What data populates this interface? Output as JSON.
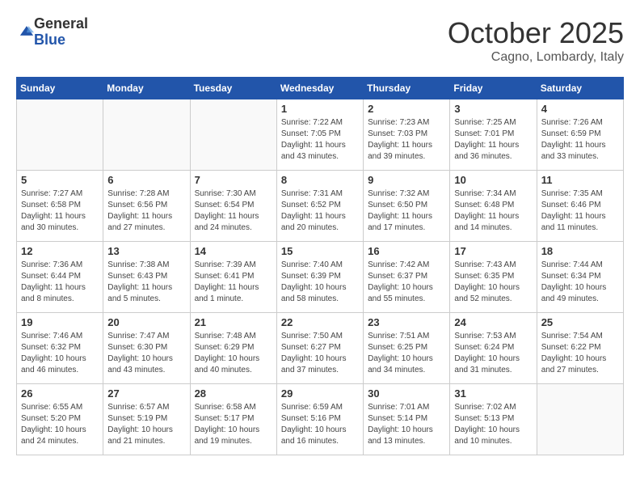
{
  "header": {
    "logo_general": "General",
    "logo_blue": "Blue",
    "month": "October 2025",
    "location": "Cagno, Lombardy, Italy"
  },
  "days_of_week": [
    "Sunday",
    "Monday",
    "Tuesday",
    "Wednesday",
    "Thursday",
    "Friday",
    "Saturday"
  ],
  "weeks": [
    [
      {
        "day": "",
        "info": ""
      },
      {
        "day": "",
        "info": ""
      },
      {
        "day": "",
        "info": ""
      },
      {
        "day": "1",
        "info": "Sunrise: 7:22 AM\nSunset: 7:05 PM\nDaylight: 11 hours\nand 43 minutes."
      },
      {
        "day": "2",
        "info": "Sunrise: 7:23 AM\nSunset: 7:03 PM\nDaylight: 11 hours\nand 39 minutes."
      },
      {
        "day": "3",
        "info": "Sunrise: 7:25 AM\nSunset: 7:01 PM\nDaylight: 11 hours\nand 36 minutes."
      },
      {
        "day": "4",
        "info": "Sunrise: 7:26 AM\nSunset: 6:59 PM\nDaylight: 11 hours\nand 33 minutes."
      }
    ],
    [
      {
        "day": "5",
        "info": "Sunrise: 7:27 AM\nSunset: 6:58 PM\nDaylight: 11 hours\nand 30 minutes."
      },
      {
        "day": "6",
        "info": "Sunrise: 7:28 AM\nSunset: 6:56 PM\nDaylight: 11 hours\nand 27 minutes."
      },
      {
        "day": "7",
        "info": "Sunrise: 7:30 AM\nSunset: 6:54 PM\nDaylight: 11 hours\nand 24 minutes."
      },
      {
        "day": "8",
        "info": "Sunrise: 7:31 AM\nSunset: 6:52 PM\nDaylight: 11 hours\nand 20 minutes."
      },
      {
        "day": "9",
        "info": "Sunrise: 7:32 AM\nSunset: 6:50 PM\nDaylight: 11 hours\nand 17 minutes."
      },
      {
        "day": "10",
        "info": "Sunrise: 7:34 AM\nSunset: 6:48 PM\nDaylight: 11 hours\nand 14 minutes."
      },
      {
        "day": "11",
        "info": "Sunrise: 7:35 AM\nSunset: 6:46 PM\nDaylight: 11 hours\nand 11 minutes."
      }
    ],
    [
      {
        "day": "12",
        "info": "Sunrise: 7:36 AM\nSunset: 6:44 PM\nDaylight: 11 hours\nand 8 minutes."
      },
      {
        "day": "13",
        "info": "Sunrise: 7:38 AM\nSunset: 6:43 PM\nDaylight: 11 hours\nand 5 minutes."
      },
      {
        "day": "14",
        "info": "Sunrise: 7:39 AM\nSunset: 6:41 PM\nDaylight: 11 hours\nand 1 minute."
      },
      {
        "day": "15",
        "info": "Sunrise: 7:40 AM\nSunset: 6:39 PM\nDaylight: 10 hours\nand 58 minutes."
      },
      {
        "day": "16",
        "info": "Sunrise: 7:42 AM\nSunset: 6:37 PM\nDaylight: 10 hours\nand 55 minutes."
      },
      {
        "day": "17",
        "info": "Sunrise: 7:43 AM\nSunset: 6:35 PM\nDaylight: 10 hours\nand 52 minutes."
      },
      {
        "day": "18",
        "info": "Sunrise: 7:44 AM\nSunset: 6:34 PM\nDaylight: 10 hours\nand 49 minutes."
      }
    ],
    [
      {
        "day": "19",
        "info": "Sunrise: 7:46 AM\nSunset: 6:32 PM\nDaylight: 10 hours\nand 46 minutes."
      },
      {
        "day": "20",
        "info": "Sunrise: 7:47 AM\nSunset: 6:30 PM\nDaylight: 10 hours\nand 43 minutes."
      },
      {
        "day": "21",
        "info": "Sunrise: 7:48 AM\nSunset: 6:29 PM\nDaylight: 10 hours\nand 40 minutes."
      },
      {
        "day": "22",
        "info": "Sunrise: 7:50 AM\nSunset: 6:27 PM\nDaylight: 10 hours\nand 37 minutes."
      },
      {
        "day": "23",
        "info": "Sunrise: 7:51 AM\nSunset: 6:25 PM\nDaylight: 10 hours\nand 34 minutes."
      },
      {
        "day": "24",
        "info": "Sunrise: 7:53 AM\nSunset: 6:24 PM\nDaylight: 10 hours\nand 31 minutes."
      },
      {
        "day": "25",
        "info": "Sunrise: 7:54 AM\nSunset: 6:22 PM\nDaylight: 10 hours\nand 27 minutes."
      }
    ],
    [
      {
        "day": "26",
        "info": "Sunrise: 6:55 AM\nSunset: 5:20 PM\nDaylight: 10 hours\nand 24 minutes."
      },
      {
        "day": "27",
        "info": "Sunrise: 6:57 AM\nSunset: 5:19 PM\nDaylight: 10 hours\nand 21 minutes."
      },
      {
        "day": "28",
        "info": "Sunrise: 6:58 AM\nSunset: 5:17 PM\nDaylight: 10 hours\nand 19 minutes."
      },
      {
        "day": "29",
        "info": "Sunrise: 6:59 AM\nSunset: 5:16 PM\nDaylight: 10 hours\nand 16 minutes."
      },
      {
        "day": "30",
        "info": "Sunrise: 7:01 AM\nSunset: 5:14 PM\nDaylight: 10 hours\nand 13 minutes."
      },
      {
        "day": "31",
        "info": "Sunrise: 7:02 AM\nSunset: 5:13 PM\nDaylight: 10 hours\nand 10 minutes."
      },
      {
        "day": "",
        "info": ""
      }
    ]
  ]
}
